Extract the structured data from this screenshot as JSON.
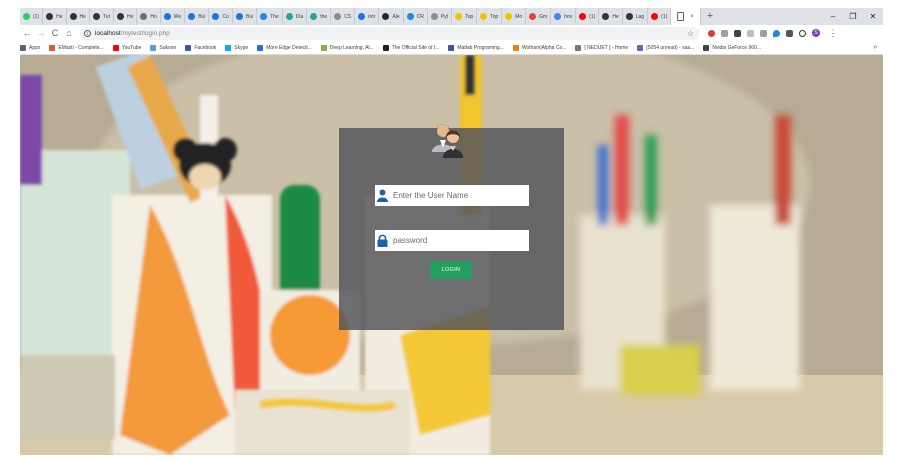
{
  "tabs": [
    {
      "label": "(1)",
      "color": "#25d366"
    },
    {
      "label": "He",
      "color": "#333333"
    },
    {
      "label": "He",
      "color": "#333333"
    },
    {
      "label": "Tut",
      "color": "#333333"
    },
    {
      "label": "He",
      "color": "#333333"
    },
    {
      "label": "Ho",
      "color": "#6f6f6f"
    },
    {
      "label": "We",
      "color": "#1a73e8"
    },
    {
      "label": "Bui",
      "color": "#1a73e8"
    },
    {
      "label": "Co",
      "color": "#1a73e8"
    },
    {
      "label": "Bui",
      "color": "#1a73e8"
    },
    {
      "label": "The",
      "color": "#1e88e5"
    },
    {
      "label": "Dia",
      "color": "#26a69a"
    },
    {
      "label": "the",
      "color": "#26a69a"
    },
    {
      "label": "CS",
      "color": "#8d8d8d"
    },
    {
      "label": "Intr",
      "color": "#1a73e8"
    },
    {
      "label": "Ale",
      "color": "#24292e"
    },
    {
      "label": "CR",
      "color": "#1e88e5"
    },
    {
      "label": "Pyt",
      "color": "#8d8d8d"
    },
    {
      "label": "Top",
      "color": "#f2c200"
    },
    {
      "label": "Top",
      "color": "#f2c200"
    },
    {
      "label": "Mo",
      "color": "#f2c200"
    },
    {
      "label": "Gm",
      "color": "#ea4335"
    },
    {
      "label": "hov",
      "color": "#4285f4"
    },
    {
      "label": "(1)",
      "color": "#ff0000"
    },
    {
      "label": "He",
      "color": "#333333"
    },
    {
      "label": "Lag",
      "color": "#333333"
    },
    {
      "label": "(1)",
      "color": "#ff0000"
    }
  ],
  "active_tab": {
    "close": "×"
  },
  "new_tab": "+",
  "window_controls": {
    "minimize": "–",
    "maximize": "❐",
    "close": "✕"
  },
  "toolbar": {
    "back": "←",
    "forward": "→",
    "reload": "C",
    "home": "⌂",
    "url_host": "localhost",
    "url_path": "/mytest/login.php",
    "star": "☆",
    "profile_initial": "S",
    "menu": "⋮"
  },
  "bookmarks": [
    {
      "label": "Apps",
      "color": "#5f6368"
    },
    {
      "label": "EMasti - Complete...",
      "color": "#e8581c"
    },
    {
      "label": "YouTube",
      "color": "#ff0000"
    },
    {
      "label": "Sukoon",
      "color": "#4aa3df"
    },
    {
      "label": "Facebook",
      "color": "#3b5998"
    },
    {
      "label": "Skype",
      "color": "#00aff0"
    },
    {
      "label": "More Edge Detecti...",
      "color": "#1a73e8"
    },
    {
      "label": "Deep Learning, Al...",
      "color": "#7cb342"
    },
    {
      "label": "The Official Site of t...",
      "color": "#222222"
    },
    {
      "label": "Matlab Programing...",
      "color": "#3b5998"
    },
    {
      "label": "Wolfram|Alpha Co...",
      "color": "#f57c00"
    },
    {
      "label": "[ NEDUET ] - Home",
      "color": "#777777"
    },
    {
      "label": "(5054 unread) - saa...",
      "color": "#5c6bc0"
    },
    {
      "label": "Nvidia GeForce 960...",
      "color": "#444444"
    }
  ],
  "bookmarks_more": "»",
  "login": {
    "username_placeholder": "Enter the User Name",
    "password_placeholder": "password",
    "button_label": "LOGIN"
  },
  "colors": {
    "panel_bg": "#505258",
    "button_bg": "#23a060",
    "icon_blue": "#1f63b0"
  }
}
